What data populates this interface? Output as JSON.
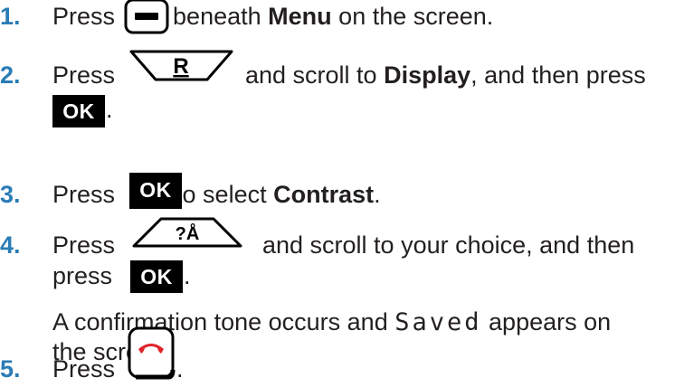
{
  "steps": [
    {
      "num": "1.",
      "press": "Press",
      "text_after": "beneath",
      "bold": "Menu",
      "text_end": "on the screen."
    },
    {
      "num": "2.",
      "press": "Press",
      "key_letter": "R",
      "text_after": "and scroll to",
      "bold": "Display",
      "text_mid": ", and then press",
      "end_dot": "."
    },
    {
      "num": "3.",
      "press": "Press",
      "text_after": "to select",
      "bold": "Contrast",
      "end_dot": "."
    },
    {
      "num": "4.",
      "press": "Press",
      "key_glyph": "?Å",
      "text_after": "and scroll to your choice, and then",
      "line2": "press",
      "end_dot": ".",
      "note_pre": "A confirmation tone occurs and",
      "note_lcd": "Saved",
      "note_post": "appears on",
      "note_line2": "the screen."
    },
    {
      "num": "5.",
      "press": "Press",
      "end_dot": "."
    }
  ],
  "ok_label": "OK",
  "colors": {
    "step_number": "#2a7cb6",
    "text": "#231f20",
    "end_call_red": "#e0242b"
  }
}
